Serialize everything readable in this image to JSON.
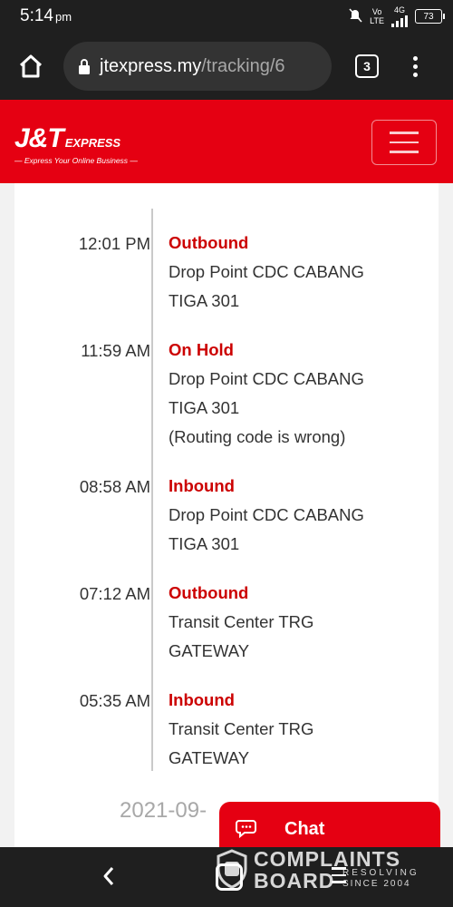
{
  "status_bar": {
    "time": "5:14",
    "ampm": "pm",
    "net_top": "Vo",
    "net_bottom": "LTE",
    "net_gen": "4G",
    "battery": "73"
  },
  "browser": {
    "url_host": "jtexpress.my",
    "url_path": "/tracking/6",
    "tab_count": "3"
  },
  "header": {
    "logo_main": "J&T",
    "logo_express": "EXPRESS",
    "logo_tagline": "— Express Your Online Business —",
    "brand_color": "#e50012"
  },
  "tracking": {
    "events": [
      {
        "time": "12:01 PM",
        "status": "Outbound",
        "lines": [
          "Drop Point CDC CABANG",
          "TIGA 301"
        ]
      },
      {
        "time": "11:59 AM",
        "status": "On Hold",
        "lines": [
          "Drop Point CDC CABANG",
          "TIGA 301",
          "(Routing code is wrong)"
        ]
      },
      {
        "time": "08:58 AM",
        "status": "Inbound",
        "lines": [
          "Drop Point CDC CABANG",
          "TIGA 301"
        ]
      },
      {
        "time": "07:12 AM",
        "status": "Outbound",
        "lines": [
          "Transit Center TRG",
          "GATEWAY"
        ]
      },
      {
        "time": "05:35 AM",
        "status": "Inbound",
        "lines": [
          "Transit Center TRG",
          "GATEWAY"
        ]
      }
    ],
    "date_partial": "2021-09-",
    "status_color": "#cc0000"
  },
  "chat": {
    "label": "Chat"
  },
  "watermark": {
    "line1": "COMPLAINTS",
    "line2": "BOARD",
    "small1": "RESOLVING",
    "small2": "SINCE 2004"
  },
  "icons": {
    "home": "home-icon",
    "lock": "lock-icon",
    "menu": "more-vert-icon",
    "hamburger": "hamburger-icon",
    "chat": "chat-bubble-icon",
    "back": "back-icon"
  }
}
